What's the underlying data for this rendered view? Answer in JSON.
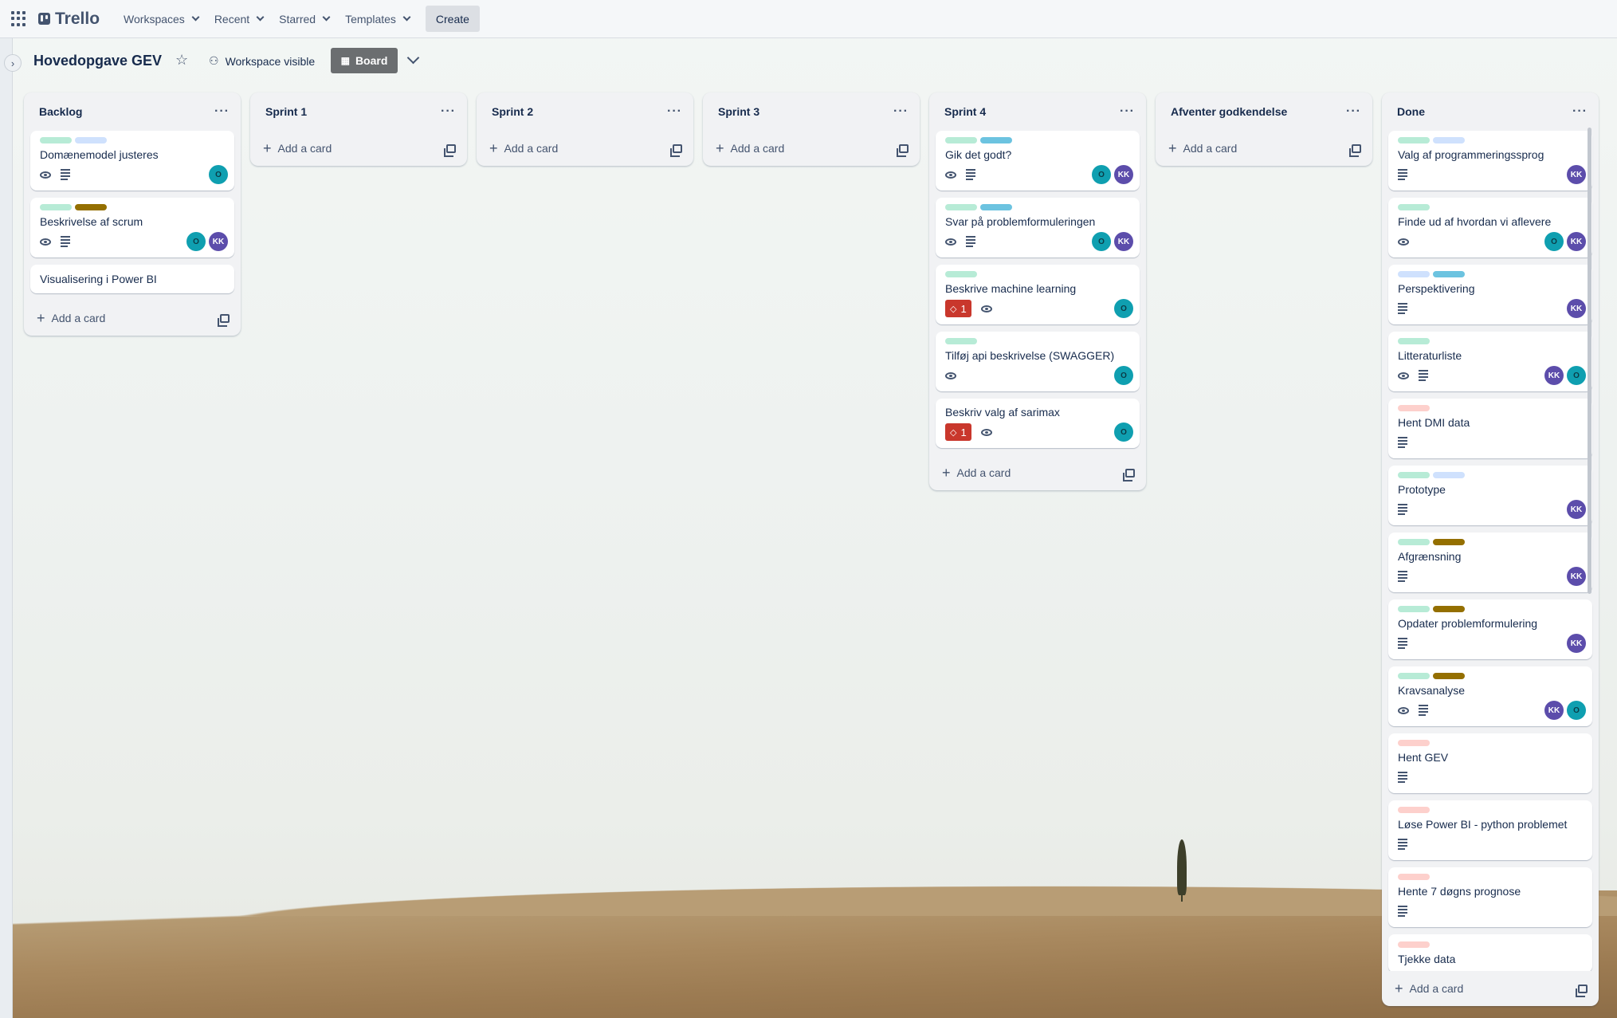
{
  "topbar": {
    "brand": "Trello",
    "nav": [
      "Workspaces",
      "Recent",
      "Starred",
      "Templates"
    ],
    "create_label": "Create"
  },
  "board": {
    "title": "Hovedopgave GEV",
    "visibility": "Workspace visible",
    "view_label": "Board"
  },
  "colors": {
    "green": "#b7ebd6",
    "lightblue": "#cfe1fd",
    "blue": "#6cc3e0",
    "olive": "#946f00",
    "pink": "#fdd0cc",
    "red_badge": "#c9372c",
    "avatar_o": "#0f9fb0",
    "avatar_kk": "#5c4dab"
  },
  "add_card_label": "Add a card",
  "lists": [
    {
      "title": "Backlog",
      "cards": [
        {
          "title": "Domænemodel justeres",
          "labels": [
            "green",
            "lightblue"
          ],
          "watch": true,
          "desc": true,
          "avatars": [
            "O"
          ]
        },
        {
          "title": "Beskrivelse af scrum",
          "labels": [
            "green",
            "olive"
          ],
          "watch": true,
          "desc": true,
          "avatars": [
            "O",
            "KK"
          ]
        },
        {
          "title": "Visualisering i Power BI",
          "labels": [],
          "watch": false,
          "desc": false,
          "avatars": []
        }
      ]
    },
    {
      "title": "Sprint 1",
      "cards": []
    },
    {
      "title": "Sprint 2",
      "cards": []
    },
    {
      "title": "Sprint 3",
      "cards": []
    },
    {
      "title": "Sprint 4",
      "cards": [
        {
          "title": "Gik det godt?",
          "labels": [
            "green",
            "blue"
          ],
          "watch": true,
          "desc": true,
          "avatars": [
            "O",
            "KK"
          ]
        },
        {
          "title": "Svar på problemformuleringen",
          "labels": [
            "green",
            "blue"
          ],
          "watch": true,
          "desc": true,
          "avatars": [
            "O",
            "KK"
          ]
        },
        {
          "title": "Beskrive machine learning",
          "labels": [
            "green"
          ],
          "badge": "1",
          "watch": true,
          "desc": false,
          "avatars": [
            "O"
          ]
        },
        {
          "title": "Tilføj api beskrivelse (SWAGGER)",
          "labels": [
            "green"
          ],
          "watch": true,
          "desc": false,
          "avatars": [
            "O"
          ]
        },
        {
          "title": "Beskriv valg af sarimax",
          "labels": [],
          "badge": "1",
          "watch": true,
          "desc": false,
          "avatars": [
            "O"
          ]
        }
      ]
    },
    {
      "title": "Afventer godkendelse",
      "cards": []
    },
    {
      "title": "Done",
      "cards": [
        {
          "title": "Valg af programmeringssprog",
          "labels": [
            "green",
            "lightblue"
          ],
          "watch": false,
          "desc": true,
          "avatars": [
            "KK"
          ]
        },
        {
          "title": "Finde ud af hvordan vi aflevere",
          "labels": [
            "green"
          ],
          "watch": true,
          "desc": false,
          "avatars": [
            "O",
            "KK"
          ]
        },
        {
          "title": "Perspektivering",
          "labels": [
            "lightblue",
            "blue"
          ],
          "watch": false,
          "desc": true,
          "avatars": [
            "KK"
          ]
        },
        {
          "title": "Litteraturliste",
          "labels": [
            "green"
          ],
          "watch": true,
          "desc": true,
          "avatars": [
            "KK",
            "O"
          ]
        },
        {
          "title": "Hent DMI data",
          "labels": [
            "pink"
          ],
          "watch": false,
          "desc": true,
          "avatars": []
        },
        {
          "title": "Prototype",
          "labels": [
            "green",
            "lightblue"
          ],
          "watch": false,
          "desc": true,
          "avatars": [
            "KK"
          ]
        },
        {
          "title": "Afgrænsning",
          "labels": [
            "green",
            "olive"
          ],
          "watch": false,
          "desc": true,
          "avatars": [
            "KK"
          ]
        },
        {
          "title": "Opdater problemformulering",
          "labels": [
            "green",
            "olive"
          ],
          "watch": false,
          "desc": true,
          "avatars": [
            "KK"
          ]
        },
        {
          "title": "Kravsanalyse",
          "labels": [
            "green",
            "olive"
          ],
          "watch": true,
          "desc": true,
          "avatars": [
            "KK",
            "O"
          ]
        },
        {
          "title": "Hent GEV",
          "labels": [
            "pink"
          ],
          "watch": false,
          "desc": true,
          "avatars": []
        },
        {
          "title": "Løse Power BI - python problemet",
          "labels": [
            "pink"
          ],
          "watch": false,
          "desc": true,
          "avatars": []
        },
        {
          "title": "Hente 7 døgns prognose",
          "labels": [
            "pink"
          ],
          "watch": false,
          "desc": true,
          "avatars": []
        },
        {
          "title": "Tjekke data",
          "labels": [
            "pink"
          ],
          "watch": false,
          "desc": false,
          "avatars": []
        }
      ]
    }
  ]
}
